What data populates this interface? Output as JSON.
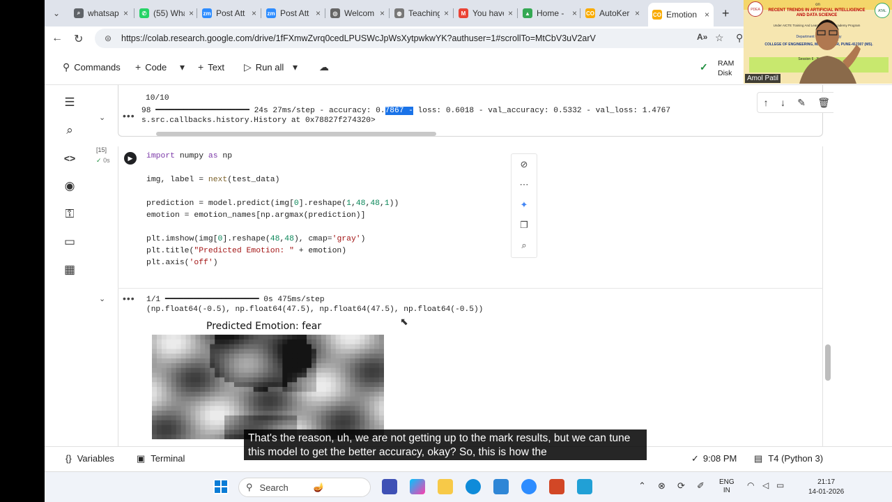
{
  "browser": {
    "tabs": [
      {
        "label": "whatsap",
        "fav_color": "#5f6368",
        "fav_glyph": "⌕"
      },
      {
        "label": "(55) Wha",
        "fav_color": "#25d366",
        "fav_glyph": "✆"
      },
      {
        "label": "Post Att",
        "fav_color": "#2d8cff",
        "fav_glyph": "zm"
      },
      {
        "label": "Post Att",
        "fav_color": "#2d8cff",
        "fav_glyph": "zm"
      },
      {
        "label": "Welcom",
        "fav_color": "#666666",
        "fav_glyph": "◎"
      },
      {
        "label": "Teaching",
        "fav_color": "#777777",
        "fav_glyph": "◍"
      },
      {
        "label": "You have",
        "fav_color": "#ea4335",
        "fav_glyph": "M"
      },
      {
        "label": "Home -",
        "fav_color": "#34a853",
        "fav_glyph": "▲"
      },
      {
        "label": "AutoKer",
        "fav_color": "#f9ab00",
        "fav_glyph": "CO"
      },
      {
        "label": "Emotion",
        "fav_color": "#f9ab00",
        "fav_glyph": "CO",
        "active": true
      }
    ],
    "new_tab": "+",
    "url": "https://colab.research.google.com/drive/1fFXmwZvrq0cedLPUSWcJpWsXytpwkwYK?authuser=1#scrollTo=MtCbV3uV2arV"
  },
  "toolbar": {
    "commands": "Commands",
    "code": "Code",
    "text": "Text",
    "run_all": "Run all",
    "ram": "RAM",
    "disk": "Disk"
  },
  "output_top": {
    "line1": "10/10",
    "line2_prefix": "98 ━━━━━━━━━━━━━━━━━━━━ 24s 27ms/step - accuracy: 0.",
    "line2_highlight": "7867 -",
    "line2_suffix": " loss: 0.6018 - val_accuracy: 0.5332 - val_loss: 1.4767",
    "line3": "s.src.callbacks.history.History at 0x78827f274320>"
  },
  "cell": {
    "exec_count": "[15]",
    "exec_time": "0s",
    "code": [
      {
        "parts": [
          [
            "kw",
            "import"
          ],
          [
            "",
            " numpy "
          ],
          [
            "kw",
            "as"
          ],
          [
            "",
            " np"
          ]
        ]
      },
      {
        "parts": []
      },
      {
        "parts": [
          [
            "",
            "img, label = "
          ],
          [
            "fn",
            "next"
          ],
          [
            "",
            "(test_data)"
          ]
        ]
      },
      {
        "parts": []
      },
      {
        "parts": [
          [
            "",
            "prediction = model.predict(img["
          ],
          [
            "num",
            "0"
          ],
          [
            "",
            "].reshape("
          ],
          [
            "num",
            "1"
          ],
          [
            "",
            ","
          ],
          [
            "num",
            "48"
          ],
          [
            "",
            ","
          ],
          [
            "num",
            "48"
          ],
          [
            "",
            ","
          ],
          [
            "num",
            "1"
          ],
          [
            "",
            "))"
          ]
        ]
      },
      {
        "parts": [
          [
            "",
            "emotion = emotion_names[np.argmax(prediction)]"
          ]
        ]
      },
      {
        "parts": []
      },
      {
        "parts": [
          [
            "",
            "plt.imshow(img["
          ],
          [
            "num",
            "0"
          ],
          [
            "",
            "].reshape("
          ],
          [
            "num",
            "48"
          ],
          [
            "",
            ","
          ],
          [
            "num",
            "48"
          ],
          [
            "",
            "), cmap="
          ],
          [
            "str",
            "'gray'"
          ],
          [
            "",
            ")"
          ]
        ]
      },
      {
        "parts": [
          [
            "",
            "plt.title("
          ],
          [
            "str",
            "\"Predicted Emotion: \""
          ],
          [
            "",
            " + emotion)"
          ]
        ]
      },
      {
        "parts": [
          [
            "",
            "plt.axis("
          ],
          [
            "str",
            "'off'"
          ],
          [
            "",
            ")"
          ]
        ]
      }
    ]
  },
  "cell_output": {
    "progress": "1/1 ━━━━━━━━━━━━━━━━━━━━ 0s 475ms/step",
    "result": "(np.float64(-0.5), np.float64(47.5), np.float64(47.5), np.float64(-0.5))",
    "plot_title": "Predicted Emotion: fear"
  },
  "statusbar": {
    "variables": "Variables",
    "terminal": "Terminal",
    "time": "9:08 PM",
    "runtime": "T4 (Python 3)"
  },
  "caption": "That's the reason, uh, we are not getting up to the mark results, but we can tune this model to get the better accuracy, okay? So, this is how the",
  "taskbar": {
    "search": "Search",
    "lang1": "ENG",
    "lang2": "IN",
    "clock": "21:17",
    "date": "14-01-2026"
  },
  "webcam": {
    "line_on": "on",
    "banner": "RECENT TRENDS IN ARTIFICIAL INTELLIGENCE AND DATA SCIENCE",
    "program": "Under AICTE Training And Learning (ATAL) Academy Program",
    "dept": "Department Of ... Technology",
    "college": "COLLEGE OF ENGINEERING, MAN... ...PSAR, PUNE-412307 (MS).",
    "session": "Session 6",
    "name_label": "Name of the ...",
    "logo_left": "PDEA",
    "logo_right": "ATAL",
    "speaker": "Amol Patil"
  }
}
